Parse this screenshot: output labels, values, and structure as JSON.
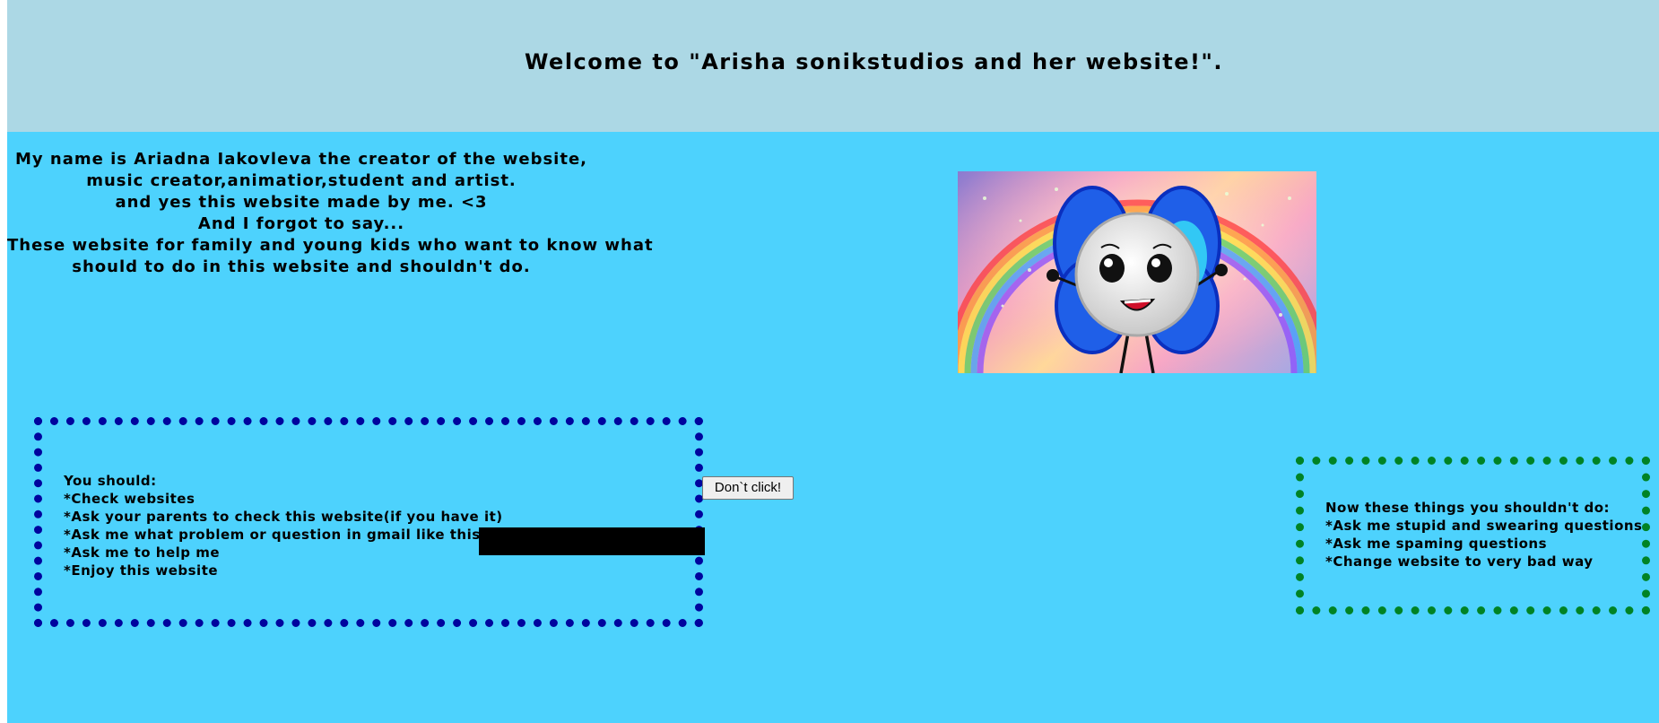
{
  "header": {
    "title": "Welcome to \"Arisha sonikstudios and her website!\"."
  },
  "intro": {
    "lines": [
      "My name is Ariadna Iakovleva the creator of the website,",
      "music creator,animatior,student and artist.",
      "and yes this website made by me. <3",
      "And I forgot to say...",
      "These website for family and young kids who want to know what",
      "should to do in this website and shouldn't do."
    ]
  },
  "should_box": {
    "lines": [
      "You should:",
      "*Check websites",
      "*Ask your parents to check this website(if you have it)",
      "*Ask me what problem or question in gmail like this",
      "*Ask me to help me",
      "*Enjoy this website"
    ]
  },
  "button": {
    "label": "Don`t click!"
  },
  "shouldnt_box": {
    "lines": [
      "Now these things you shouldn't do:",
      "*Ask me stupid and swearing questions",
      "*Ask me spaming questions",
      "*Change website to very bad way"
    ]
  },
  "colors": {
    "header_bg": "#acd8e5",
    "page_bg": "#4dd2fd",
    "should_border": "#00049e",
    "shouldnt_border": "#008325"
  }
}
